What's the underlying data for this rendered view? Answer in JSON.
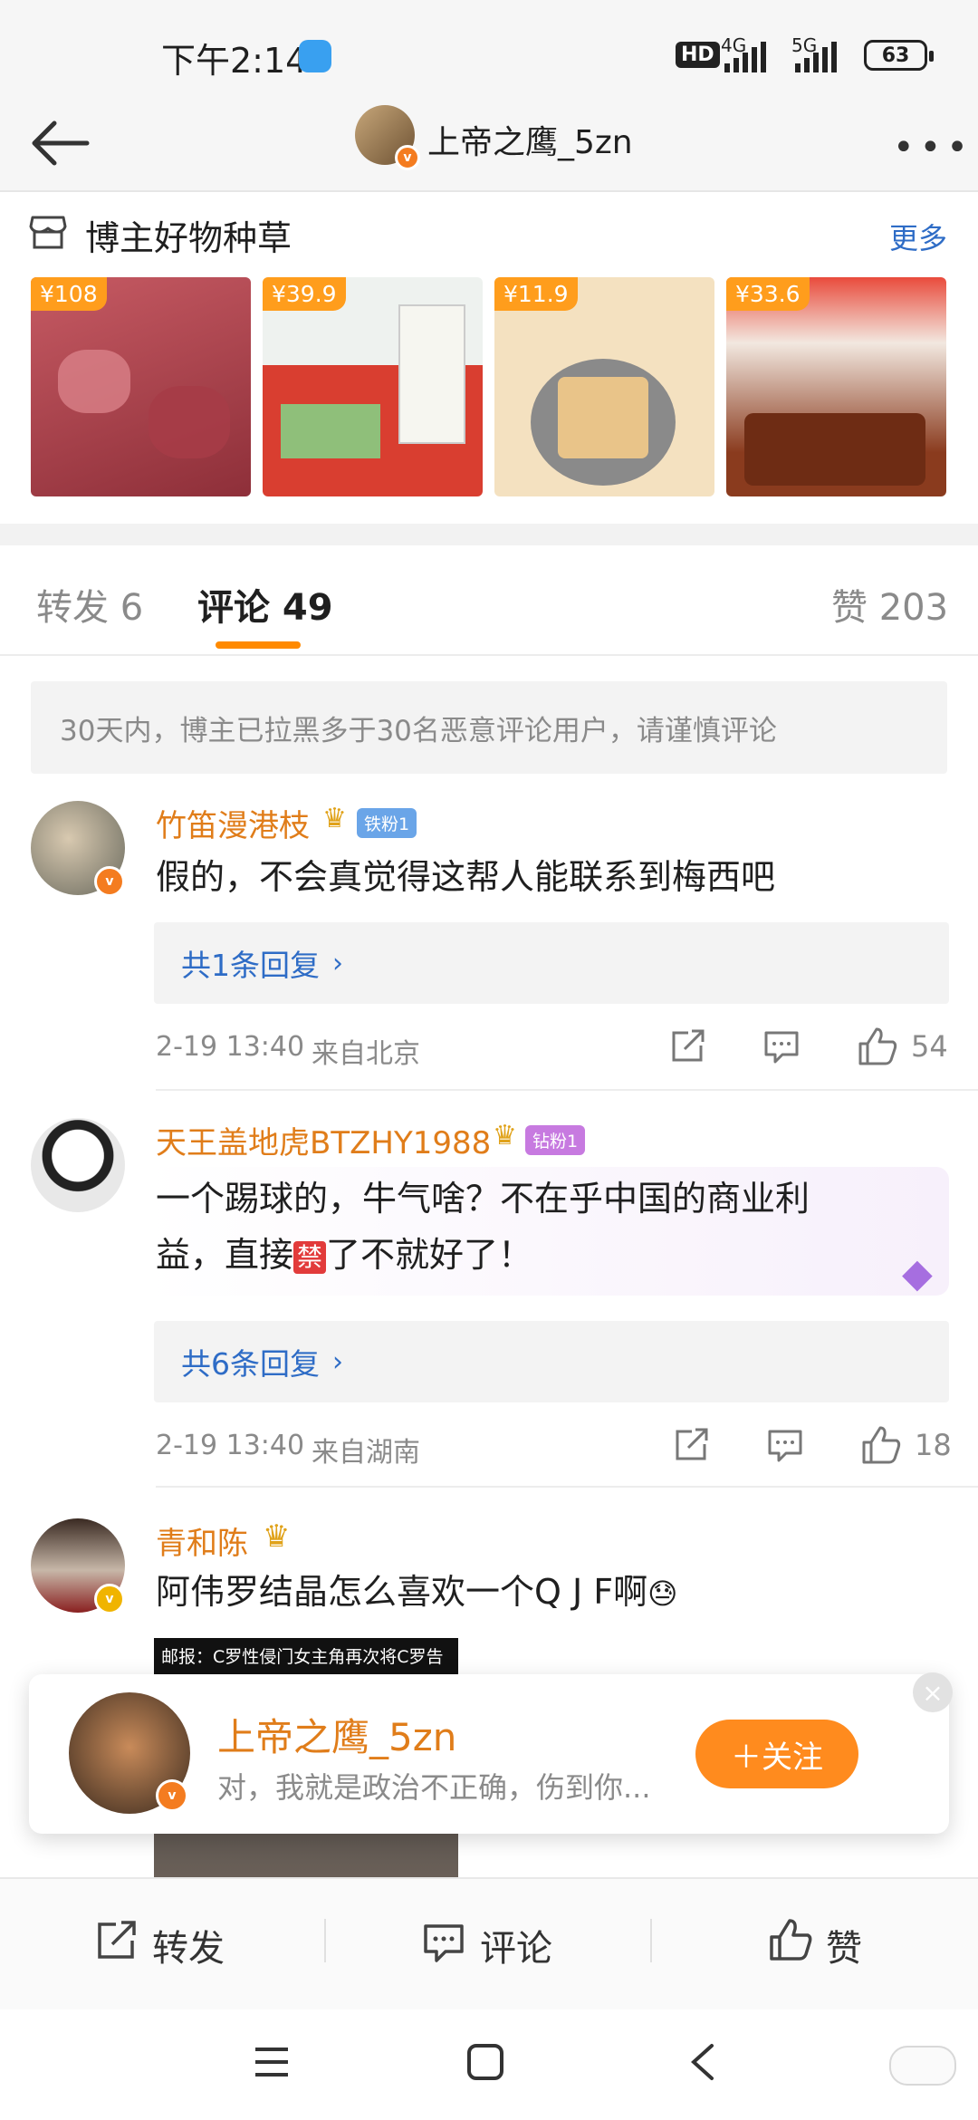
{
  "status": {
    "time": "下午2:14",
    "hd": "HD",
    "net1": "4G",
    "net2": "5G",
    "battery": "63"
  },
  "header": {
    "username": "上帝之鹰_5zn"
  },
  "goods": {
    "title": "博主好物种草",
    "more": "更多",
    "items": [
      {
        "price": "¥108",
        "color": "#b8474f"
      },
      {
        "price": "¥39.9",
        "color": "#d94a3a"
      },
      {
        "price": "¥11.9",
        "color": "#f2dcb6"
      },
      {
        "price": "¥33.6",
        "color": "#b0532c"
      }
    ]
  },
  "tabs": {
    "repost": "转发 6",
    "comments": "评论 49",
    "likes": "赞 203"
  },
  "notice": "30天内，博主已拉黑多于30名恶意评论用户，请谨慎评论",
  "comments": [
    {
      "name": "竹笛漫港枝",
      "badge": "铁粉1",
      "text": "假的，不会真觉得这帮人能联系到梅西吧",
      "replies": "共1条回复",
      "time": "2-19 13:40",
      "from": "来自北京",
      "likes": "54"
    },
    {
      "name": "天王盖地虎BTZHY1988",
      "badge": "钻粉1",
      "text_line1": "一个踢球的，牛气啥？不在乎中国的商业利",
      "text_line2_a": "益，直接",
      "text_line2_emoji": "禁",
      "text_line2_b": "了不就好了！",
      "replies": "共6条回复",
      "time": "2-19 13:40",
      "from": "来自湖南",
      "likes": "18"
    },
    {
      "name": "青和陈",
      "text": "阿伟罗结晶怎么喜欢一个Q J F啊",
      "emoji": "😓",
      "image_caption": "邮报：C罗性侵门女主角再次将C罗告"
    }
  ],
  "popup": {
    "name": "上帝之鹰_5zn",
    "text": "对，我就是政治不正确，伤到你...",
    "follow": "＋关注",
    "close": "×"
  },
  "actions": {
    "repost": "转发",
    "comment": "评论",
    "like": "赞"
  },
  "colors": {
    "accent": "#ff8b1e",
    "link": "#2e6cc6",
    "username": "#e07d1a"
  }
}
